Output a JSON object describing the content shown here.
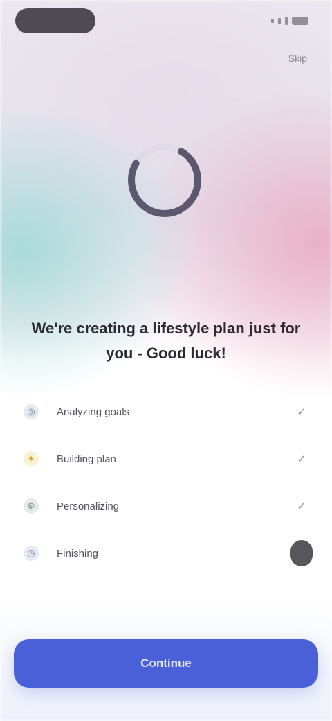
{
  "header": {
    "action_label": "Skip"
  },
  "progress": {
    "fraction": 0.75
  },
  "main": {
    "title": "We're creating a lifestyle plan just for you - Good luck!"
  },
  "steps": [
    {
      "label": "Analyzing goals",
      "icon": "target-icon",
      "status": "done",
      "status_glyph": "✓"
    },
    {
      "label": "Building plan",
      "icon": "spark-icon",
      "status": "done",
      "status_glyph": "✓"
    },
    {
      "label": "Personalizing",
      "icon": "gear-icon",
      "status": "done",
      "status_glyph": "✓"
    },
    {
      "label": "Finishing",
      "icon": "clock-icon",
      "status": "active",
      "status_glyph": ""
    }
  ],
  "cta": {
    "label": "Continue"
  },
  "colors": {
    "accent": "#4a60d8",
    "spinner": "#5c5870",
    "step_icon_1": "#6c8aa2",
    "step_icon_2": "#e8c24a",
    "step_icon_3": "#7a9a8e",
    "step_icon_4": "#8a94b8"
  }
}
